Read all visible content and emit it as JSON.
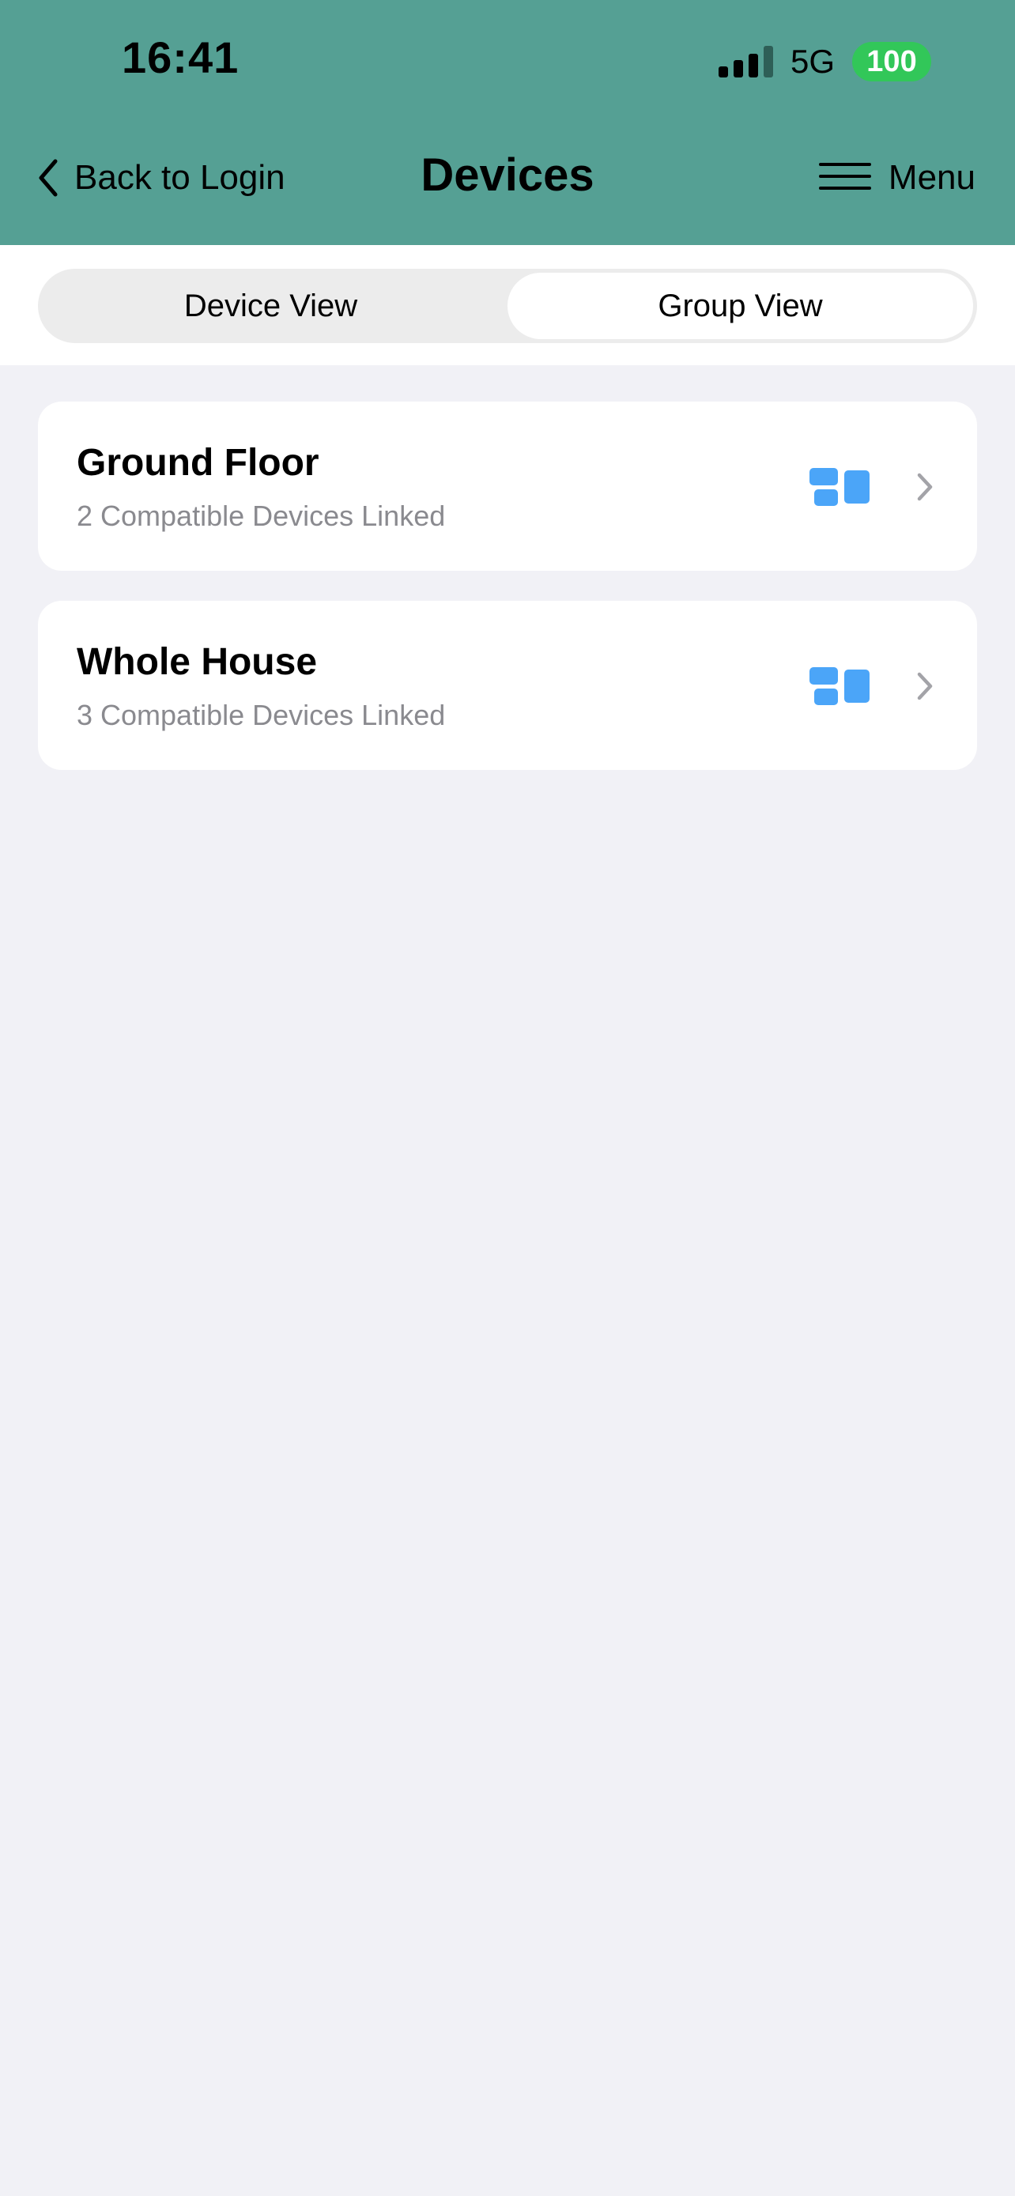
{
  "status_bar": {
    "time": "16:41",
    "network": "5G",
    "battery": "100"
  },
  "nav": {
    "back_label": "Back to Login",
    "title": "Devices",
    "menu_label": "Menu"
  },
  "segments": {
    "device_view": "Device View",
    "group_view": "Group View",
    "selected": "Group View"
  },
  "groups": [
    {
      "name": "Ground Floor",
      "subtitle": "2 Compatible Devices Linked",
      "icon": "group-tiles-icon"
    },
    {
      "name": "Whole House",
      "subtitle": "3 Compatible Devices Linked",
      "icon": "group-tiles-icon"
    }
  ],
  "colors": {
    "header_background": "#55a094",
    "battery_background": "#32c759",
    "group_icon": "#4ba5f8",
    "page_background": "#f1f1f6"
  }
}
